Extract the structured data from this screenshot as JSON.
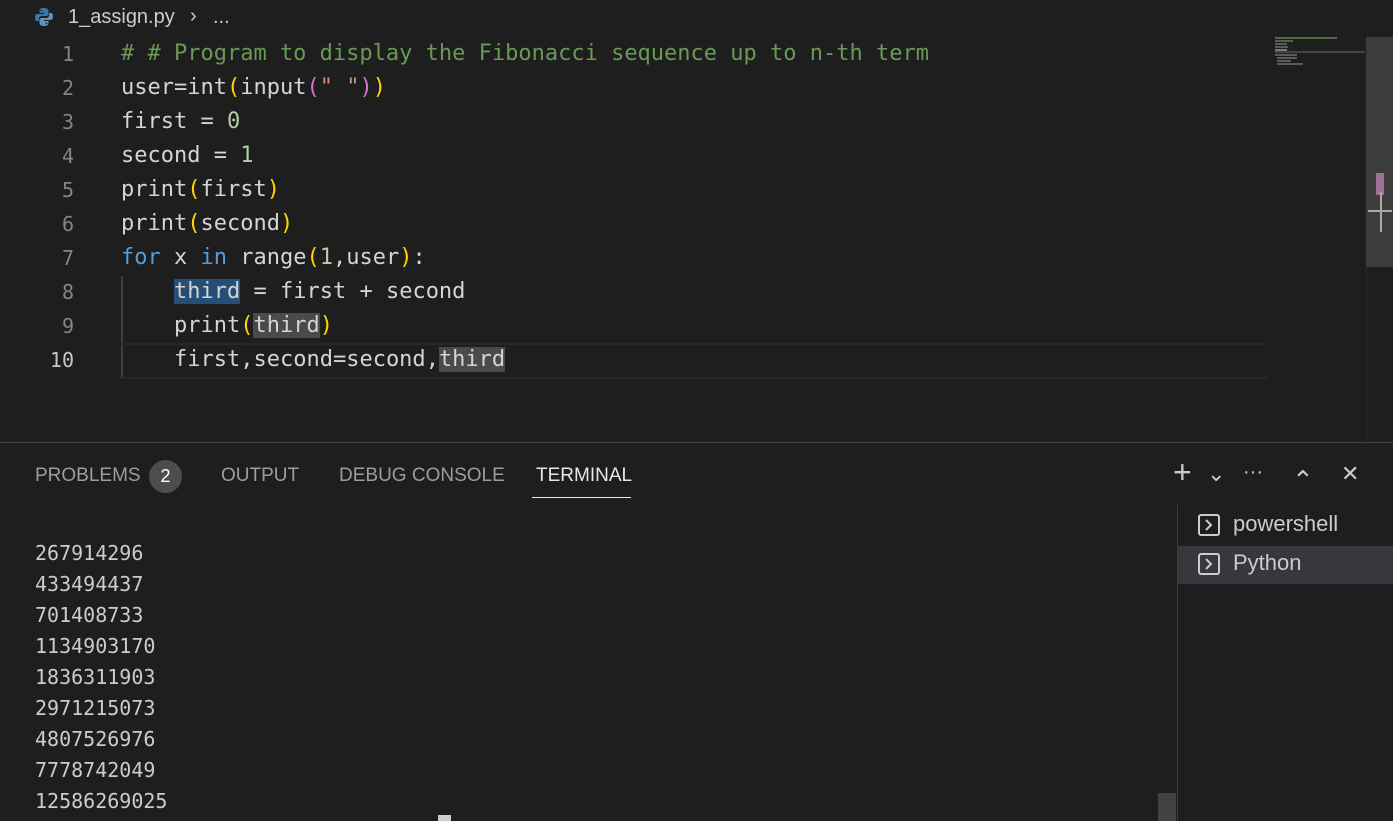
{
  "breadcrumb": {
    "file": "1_assign.py",
    "separator": "›",
    "more": "..."
  },
  "editor": {
    "lines": [
      {
        "n": "1"
      },
      {
        "n": "2"
      },
      {
        "n": "3"
      },
      {
        "n": "4"
      },
      {
        "n": "5"
      },
      {
        "n": "6"
      },
      {
        "n": "7"
      },
      {
        "n": "8"
      },
      {
        "n": "9"
      },
      {
        "n": "10"
      }
    ],
    "tokens": {
      "l1": "# # Program to display the Fibonacci sequence up to n-th term",
      "user": "user",
      "eq": "=",
      "int": "int",
      "input": "input",
      "str1": "\" \"",
      "first": "first",
      "second": "second",
      "assign": " = ",
      "zero": "0",
      "one": "1",
      "print": "print",
      "for": "for",
      "x": "x",
      "in": "in",
      "range": "range",
      "range_args_sep": ",",
      "colon": ":",
      "third": "third",
      "plus": " + ",
      "lp": "(",
      "rp": ")",
      "comma": ",",
      "indent": "    ",
      "space": " "
    }
  },
  "panel": {
    "tabs": [
      {
        "label": "PROBLEMS"
      },
      {
        "label": "OUTPUT"
      },
      {
        "label": "DEBUG CONSOLE"
      },
      {
        "label": "TERMINAL"
      }
    ],
    "problems_count": "2",
    "actions": {
      "add": "+",
      "dropdown": "⌄",
      "more": "···",
      "maximize": "⌃",
      "close": "✕"
    }
  },
  "terminal": {
    "output": [
      "267914296",
      "433494437",
      "701408733",
      "1134903170",
      "1836311903",
      "2971215073",
      "4807526976",
      "7778742049",
      "12586269025"
    ],
    "instances": [
      {
        "label": "powershell",
        "selected": false
      },
      {
        "label": "Python",
        "selected": true
      }
    ]
  },
  "colors": {
    "background": "#1e1e1e",
    "keyword": "#569cd6",
    "comment": "#6a9955",
    "number": "#b5cea8",
    "string": "#ce9178",
    "bracket1": "#ffd700",
    "bracket2": "#da70d6",
    "selection": "#264f78"
  }
}
